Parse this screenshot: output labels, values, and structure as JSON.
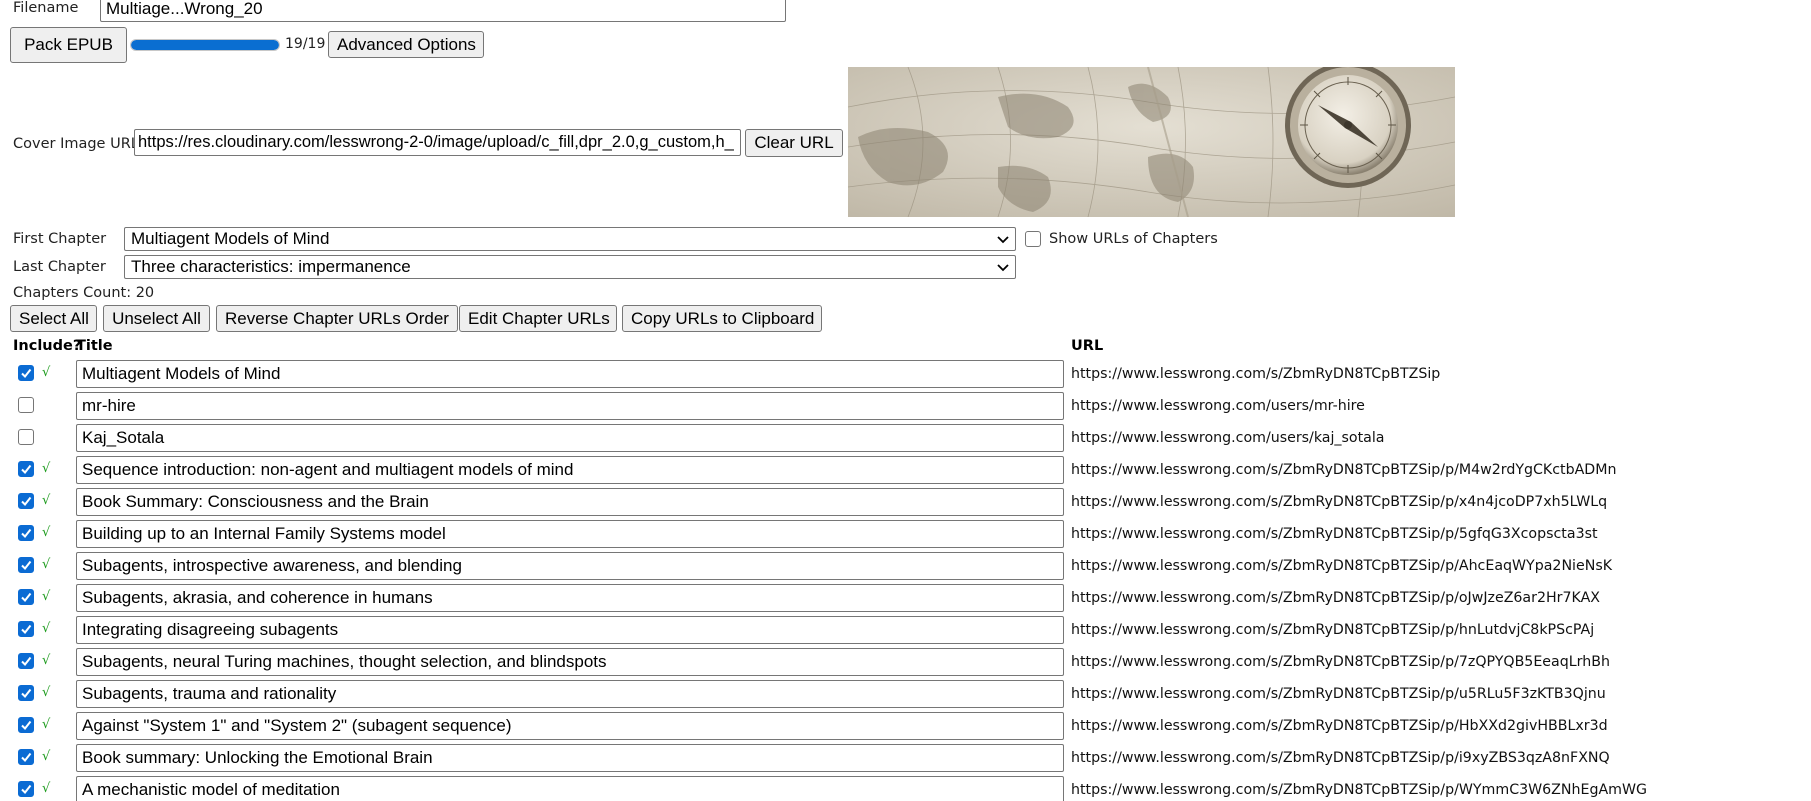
{
  "filename": {
    "label": "Filename",
    "value": "Multiage...Wrong_20"
  },
  "toolbar": {
    "pack_label": "Pack EPUB",
    "progress_text": "19/19",
    "progress_fraction": 1.0,
    "advanced_label": "Advanced Options"
  },
  "cover": {
    "label": "Cover Image URL:",
    "value": "https://res.cloudinary.com/lesswrong-2-0/image/upload/c_fill,dpr_2.0,g_custom,h_",
    "clear_label": "Clear URL"
  },
  "range": {
    "first_label": "First Chapter",
    "first_value": "Multiagent Models of Mind",
    "last_label": "Last Chapter",
    "last_value": "Three characteristics: impermanence",
    "show_urls_label": "Show URLs of Chapters",
    "show_urls_checked": false
  },
  "count_text": "Chapters Count: 20",
  "actions": {
    "select_all": "Select All",
    "unselect_all": "Unselect All",
    "reverse": "Reverse Chapter URLs Order",
    "edit": "Edit Chapter URLs",
    "copy": "Copy URLs to Clipboard"
  },
  "table": {
    "col_include": "Include?",
    "col_title": "Title",
    "col_url": "URL",
    "rows": [
      {
        "checked": true,
        "status": "√",
        "title": "Multiagent Models of Mind",
        "url": "https://www.lesswrong.com/s/ZbmRyDN8TCpBTZSip"
      },
      {
        "checked": false,
        "status": "",
        "title": "mr-hire",
        "url": "https://www.lesswrong.com/users/mr-hire"
      },
      {
        "checked": false,
        "status": "",
        "title": "Kaj_Sotala",
        "url": "https://www.lesswrong.com/users/kaj_sotala"
      },
      {
        "checked": true,
        "status": "√",
        "title": "Sequence introduction: non-agent and multiagent models of mind",
        "url": "https://www.lesswrong.com/s/ZbmRyDN8TCpBTZSip/p/M4w2rdYgCKctbADMn"
      },
      {
        "checked": true,
        "status": "√",
        "title": "Book Summary: Consciousness and the Brain",
        "url": "https://www.lesswrong.com/s/ZbmRyDN8TCpBTZSip/p/x4n4jcoDP7xh5LWLq"
      },
      {
        "checked": true,
        "status": "√",
        "title": "Building up to an Internal Family Systems model",
        "url": "https://www.lesswrong.com/s/ZbmRyDN8TCpBTZSip/p/5gfqG3Xcopscta3st"
      },
      {
        "checked": true,
        "status": "√",
        "title": "Subagents, introspective awareness, and blending",
        "url": "https://www.lesswrong.com/s/ZbmRyDN8TCpBTZSip/p/AhcEaqWYpa2NieNsK"
      },
      {
        "checked": true,
        "status": "√",
        "title": "Subagents, akrasia, and coherence in humans",
        "url": "https://www.lesswrong.com/s/ZbmRyDN8TCpBTZSip/p/oJwJzeZ6ar2Hr7KAX"
      },
      {
        "checked": true,
        "status": "√",
        "title": "Integrating disagreeing subagents",
        "url": "https://www.lesswrong.com/s/ZbmRyDN8TCpBTZSip/p/hnLutdvjC8kPScPAj"
      },
      {
        "checked": true,
        "status": "√",
        "title": "Subagents, neural Turing machines, thought selection, and blindspots",
        "url": "https://www.lesswrong.com/s/ZbmRyDN8TCpBTZSip/p/7zQPYQB5EeaqLrhBh"
      },
      {
        "checked": true,
        "status": "√",
        "title": "Subagents, trauma and rationality",
        "url": "https://www.lesswrong.com/s/ZbmRyDN8TCpBTZSip/p/u5RLu5F3zKTB3Qjnu"
      },
      {
        "checked": true,
        "status": "√",
        "title": "Against \"System 1\" and \"System 2\" (subagent sequence)",
        "url": "https://www.lesswrong.com/s/ZbmRyDN8TCpBTZSip/p/HbXXd2givHBBLxr3d"
      },
      {
        "checked": true,
        "status": "√",
        "title": "Book summary: Unlocking the Emotional Brain",
        "url": "https://www.lesswrong.com/s/ZbmRyDN8TCpBTZSip/p/i9xyZBS3qzA8nFXNQ"
      },
      {
        "checked": true,
        "status": "√",
        "title": "A mechanistic model of meditation",
        "url": "https://www.lesswrong.com/s/ZbmRyDN8TCpBTZSip/p/WYmmC3W6ZNhEgAmWG"
      }
    ]
  },
  "colors": {
    "accent": "#0a6ed1",
    "tick": "#1a9a1a"
  },
  "icons": {
    "dropdown": "chevron-down-icon",
    "checkmark": "check-icon"
  }
}
